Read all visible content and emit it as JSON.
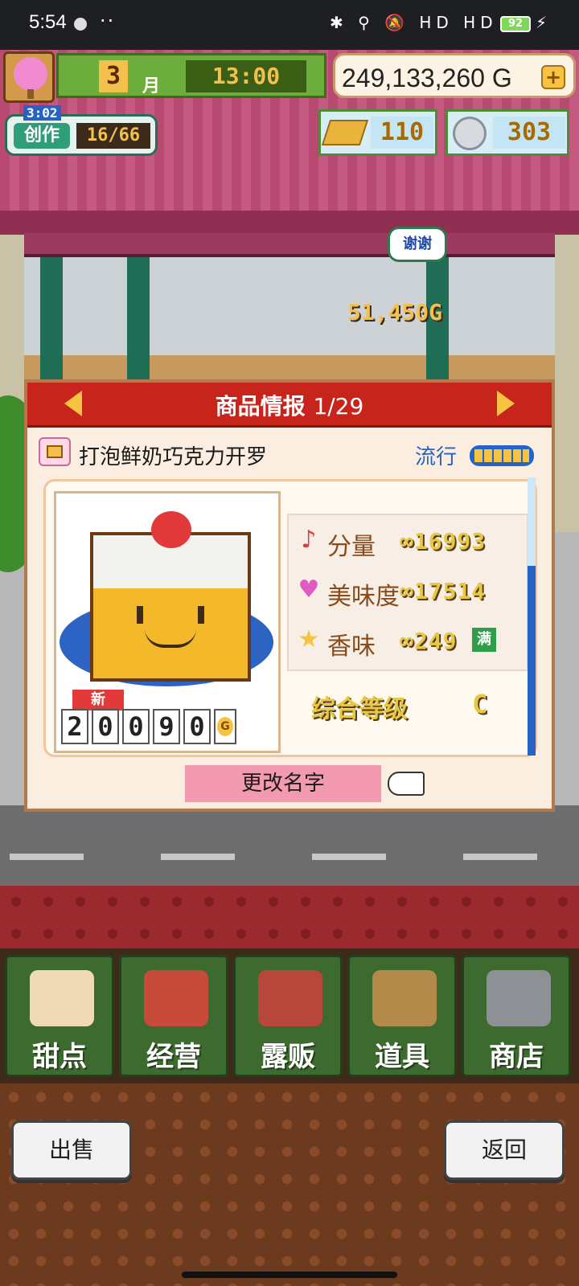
{
  "status_bar": {
    "time": "5:54",
    "more": "··",
    "icons": "✱ ⚲ 🔕 HD HD ≋",
    "battery": "92",
    "charging": "⚡"
  },
  "hud": {
    "month": "3",
    "month_label": "月",
    "clock": "13:00",
    "money": "249,133,260 G",
    "money_plus": "+",
    "create_timer": "3:02",
    "create_label": "创作",
    "create_count": "16/66",
    "gold_bars": "110",
    "medals": "303"
  },
  "scene": {
    "speech_bubble": "谢谢",
    "floating_money": "51,450G"
  },
  "panel": {
    "title": "商品情报",
    "pager": "1/29",
    "product_name": "打泡鲜奶巧克力开罗",
    "trend_label": "流行",
    "trend_level": 1.0,
    "new_badge": "新",
    "price_digits": [
      "2",
      "0",
      "0",
      "9",
      "0"
    ],
    "price_unit": "G",
    "stats": [
      {
        "icon": "♪",
        "label": "分量",
        "value": "∞16993",
        "color": "#e23a3a"
      },
      {
        "icon": "♥",
        "label": "美味度",
        "value": "∞17514",
        "color": "#e05cc0"
      },
      {
        "icon": "★",
        "label": "香味",
        "value": "∞249  9",
        "color": "#f6c343"
      }
    ],
    "full_badge": "满",
    "grade_label": "综合等级",
    "grade": "C",
    "rename_button": "更改名字"
  },
  "bottom_nav": [
    {
      "label": "甜点",
      "icon": "cake-icon"
    },
    {
      "label": "经营",
      "icon": "store-icon"
    },
    {
      "label": "露贩",
      "icon": "food-truck-icon"
    },
    {
      "label": "道具",
      "icon": "tools-bag-icon"
    },
    {
      "label": "商店",
      "icon": "shopping-cart-icon"
    }
  ],
  "actions": {
    "sell": "出售",
    "back": "返回"
  }
}
